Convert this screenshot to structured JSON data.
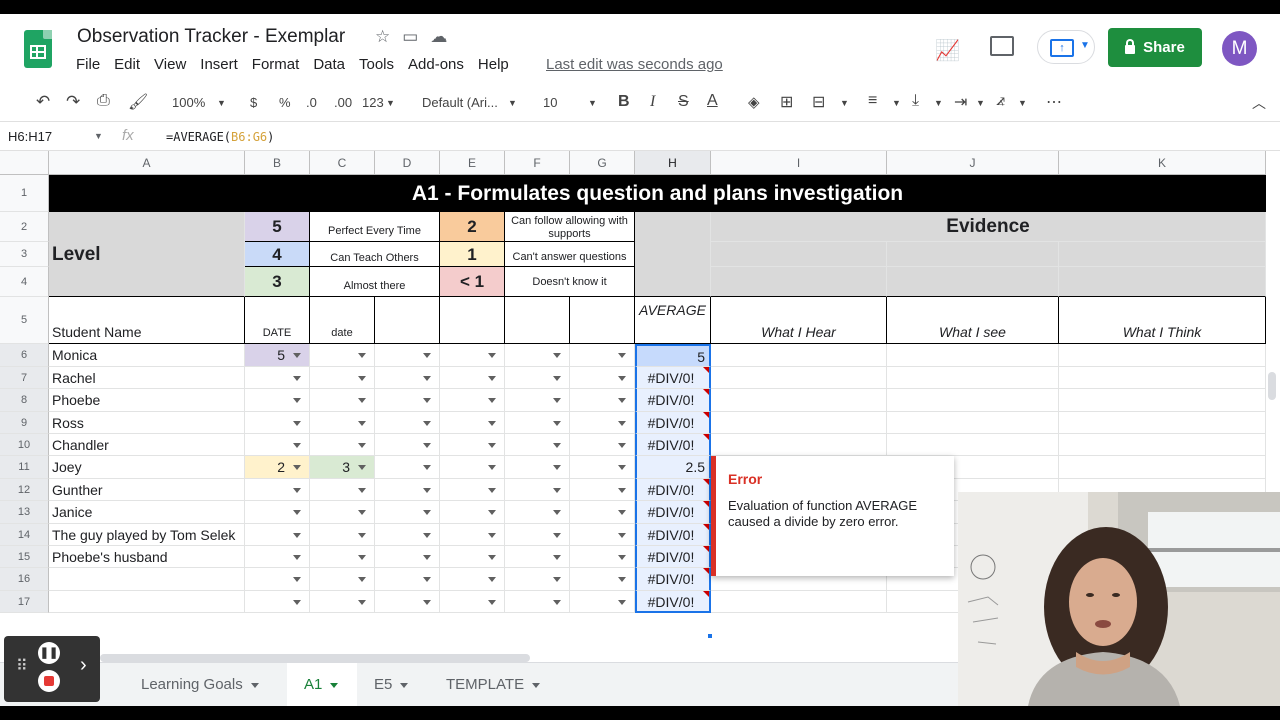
{
  "doc": {
    "title": "Observation Tracker - Exemplar",
    "last_edit": "Last edit was seconds ago",
    "share_label": "Share",
    "avatar_letter": "M"
  },
  "menus": [
    "File",
    "Edit",
    "View",
    "Insert",
    "Format",
    "Data",
    "Tools",
    "Add-ons",
    "Help"
  ],
  "toolbar": {
    "zoom": "100%",
    "currency": "$",
    "percent": "%",
    "dec_less": ".0",
    "dec_more": ".00",
    "format_more": "123",
    "font": "Default (Ari...",
    "font_size": "10",
    "bold": "B",
    "italic": "I",
    "strike": "S",
    "text_color": "A",
    "more": "⋯"
  },
  "formula_bar": {
    "name_box": "H6:H17",
    "fx": "fx",
    "formula_prefix": "=AVERAGE(",
    "formula_ref": "B6:G6",
    "formula_suffix": ")"
  },
  "columns": [
    "A",
    "B",
    "C",
    "D",
    "E",
    "F",
    "G",
    "H",
    "I",
    "J",
    "K"
  ],
  "rows": [
    "1",
    "2",
    "3",
    "4",
    "5",
    "6",
    "7",
    "8",
    "9",
    "10",
    "11",
    "12",
    "13",
    "14",
    "15",
    "16",
    "17"
  ],
  "sheet": {
    "banner": "A1 - Formulates question and plans investigation",
    "level": "Level",
    "evidence": "Evidence",
    "legend": {
      "l5": "5",
      "l5_text": "Perfect Every Time",
      "l4": "4",
      "l4_text": "Can Teach Others",
      "l3": "3",
      "l3_text": "Almost there",
      "l2": "2",
      "l2_text": "Can follow allowing with supports",
      "l1": "1",
      "l1_text": "Can't answer questions",
      "l0": "< 1",
      "l0_text": "Doesn't know it"
    },
    "headers": {
      "student": "Student Name",
      "date1": "DATE",
      "date2": "date",
      "average": "AVERAGE",
      "hear": "What I Hear",
      "see": "What I see",
      "think": "What I Think"
    },
    "students": [
      {
        "name": "Monica",
        "b": "5",
        "c": "",
        "avg": "5"
      },
      {
        "name": "Rachel",
        "b": "",
        "c": "",
        "avg": "#DIV/0!"
      },
      {
        "name": "Phoebe",
        "b": "",
        "c": "",
        "avg": "#DIV/0!"
      },
      {
        "name": "Ross",
        "b": "",
        "c": "",
        "avg": "#DIV/0!"
      },
      {
        "name": "Chandler",
        "b": "",
        "c": "",
        "avg": "#DIV/0!"
      },
      {
        "name": "Joey",
        "b": "2",
        "c": "3",
        "avg": "2.5"
      },
      {
        "name": "Gunther",
        "b": "",
        "c": "",
        "avg": "#DIV/0!"
      },
      {
        "name": "Janice",
        "b": "",
        "c": "",
        "avg": "#DIV/0!"
      },
      {
        "name": "The guy played by Tom Selek",
        "b": "",
        "c": "",
        "avg": "#DIV/0!"
      },
      {
        "name": "Phoebe's husband",
        "b": "",
        "c": "",
        "avg": "#DIV/0!"
      },
      {
        "name": "",
        "b": "",
        "c": "",
        "avg": "#DIV/0!"
      },
      {
        "name": "",
        "b": "",
        "c": "",
        "avg": "#DIV/0!"
      }
    ]
  },
  "tooltip": {
    "title": "Error",
    "body": "Evaluation of function AVERAGE caused a divide by zero error."
  },
  "tabs": [
    "Learning Goals",
    "A1",
    "E5",
    "TEMPLATE"
  ],
  "colors": {
    "l5": "#d9d2e9",
    "l4": "#c9daf8",
    "l3": "#d9ead3",
    "l2": "#f9cb9c",
    "l1": "#fff2cc",
    "l0": "#f4cccc",
    "selection": "#e8f0fe",
    "accent": "#1a73e8",
    "share": "#1e8e3e"
  }
}
